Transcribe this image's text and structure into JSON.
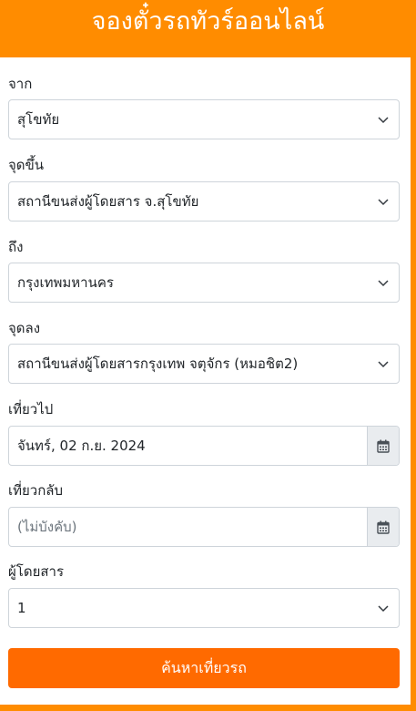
{
  "header": {
    "title": "จองตั๋วรถทัวร์ออนไลน์"
  },
  "form": {
    "from": {
      "label": "จาก",
      "value": "สุโขทัย"
    },
    "pickup": {
      "label": "จุดขึ้น",
      "value": "สถานีขนส่งผู้โดยสาร จ.สุโขทัย"
    },
    "to": {
      "label": "ถึง",
      "value": "กรุงเทพมหานคร"
    },
    "dropoff": {
      "label": "จุดลง",
      "value": "สถานีขนส่งผู้โดยสารกรุงเทพ จตุจักร (หมอชิต2)"
    },
    "depart": {
      "label": "เที่ยวไป",
      "value": "จันทร์, 02 ก.ย. 2024"
    },
    "return": {
      "label": "เที่ยวกลับ",
      "placeholder": "(ไม่บังคับ)"
    },
    "passengers": {
      "label": "ผู้โดยสาร",
      "value": "1"
    },
    "submit_label": "ค้นหาเที่ยวรถ"
  },
  "icons": {
    "select_arrow": "chevron-down-icon",
    "date_picker": "calendar-icon"
  },
  "colors": {
    "brand_orange": "#ff8c00",
    "button_orange": "#ff6a00"
  }
}
